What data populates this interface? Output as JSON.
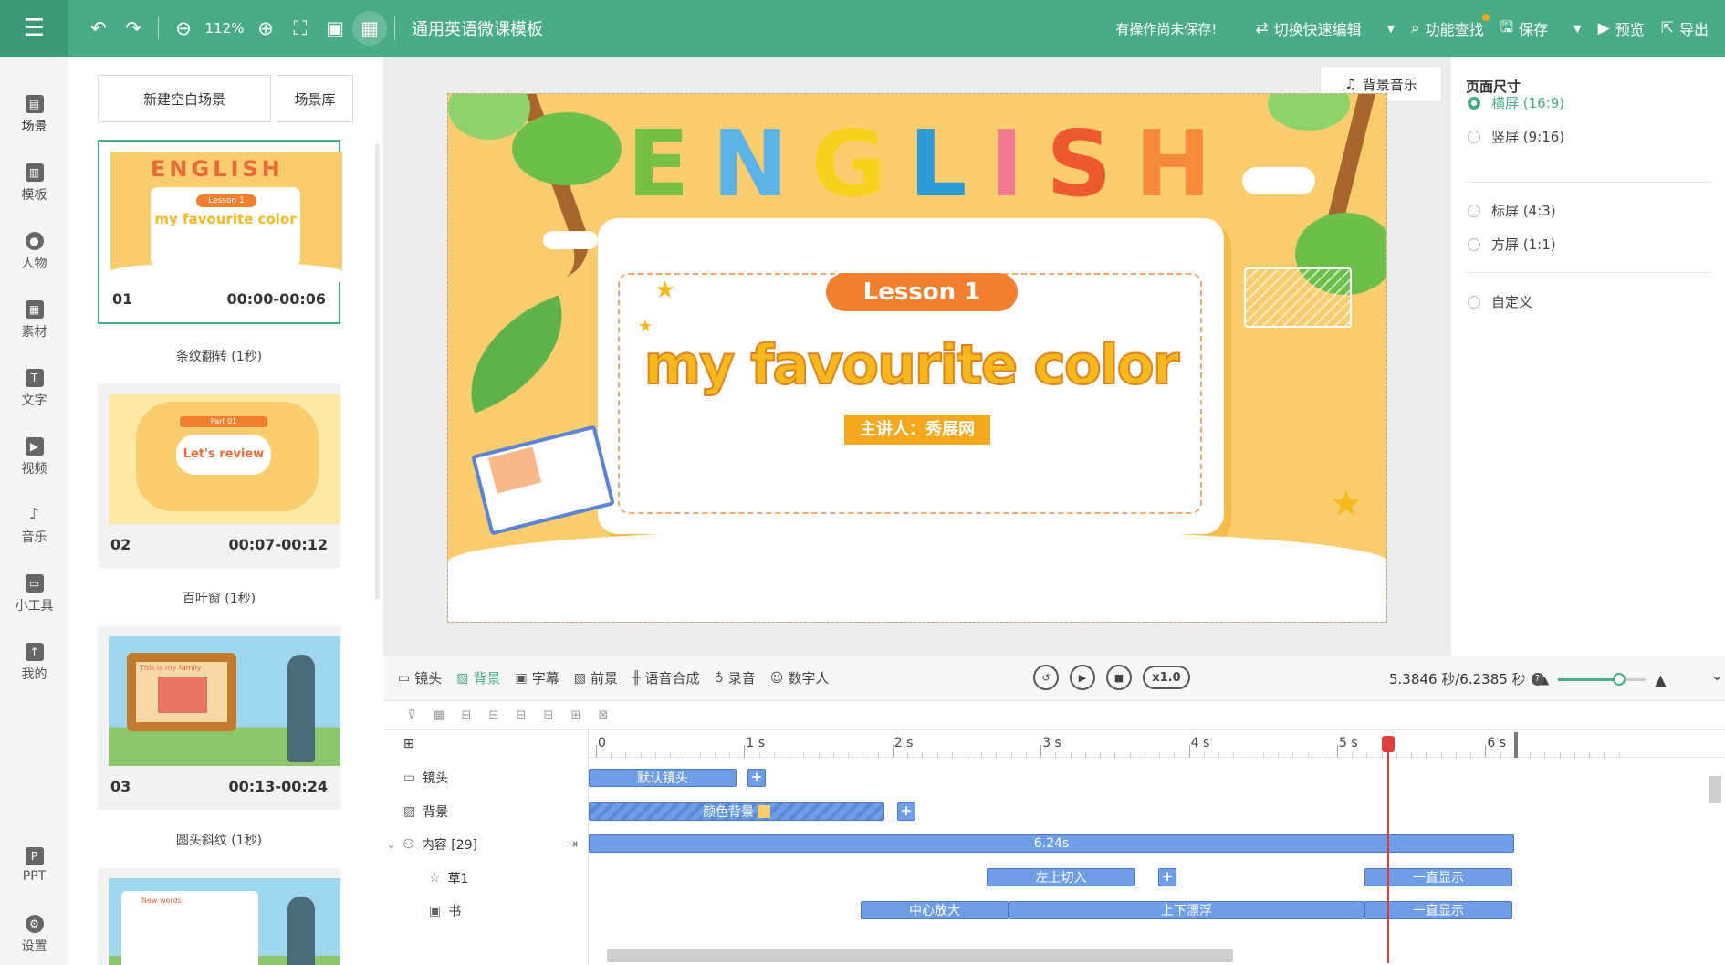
{
  "topbar": {
    "zoom": "112%",
    "app_title": "通用英语微课模板",
    "unsaved_notice": "有操作尚未保存!",
    "quick_edit": "切换快速编辑",
    "feature_search": "功能查找",
    "save": "保存",
    "preview": "预览",
    "export": "导出",
    "accent_color": "#4aac86"
  },
  "leftnav": {
    "items": [
      {
        "label": "场景",
        "icon": "scene-icon"
      },
      {
        "label": "模板",
        "icon": "template-icon"
      },
      {
        "label": "人物",
        "icon": "person-icon"
      },
      {
        "label": "素材",
        "icon": "material-icon"
      },
      {
        "label": "文字",
        "icon": "text-icon"
      },
      {
        "label": "视频",
        "icon": "video-icon"
      },
      {
        "label": "音乐",
        "icon": "music-icon"
      },
      {
        "label": "小工具",
        "icon": "toolbox-icon"
      },
      {
        "label": "我的",
        "icon": "upload-icon"
      },
      {
        "label": "PPT",
        "icon": "ppt-icon"
      },
      {
        "label": "设置",
        "icon": "gear-icon"
      }
    ]
  },
  "scenes": {
    "new_blank": "新建空白场景",
    "library": "场景库",
    "items": [
      {
        "num": "01",
        "time": "00:00-00:06",
        "transition": "条纹翻转 (1秒)"
      },
      {
        "num": "02",
        "time": "00:07-00:12",
        "transition": "百叶窗 (1秒)"
      },
      {
        "num": "03",
        "time": "00:13-00:24",
        "transition": "圆头斜纹 (1秒)"
      }
    ],
    "thumb1": {
      "title": "ENGLISH",
      "lesson": "Lesson 1",
      "subtitle": "my favourite color"
    },
    "thumb2": {
      "part": "Part 01",
      "text": "Let's review"
    },
    "thumb3": {
      "caption": "This is my family"
    },
    "thumb4": {
      "caption": "New words"
    }
  },
  "canvas": {
    "bgm_button": "背景音乐",
    "title_letters": [
      "E",
      "N",
      "G",
      "L",
      "I",
      "S",
      "H"
    ],
    "lesson": "Lesson 1",
    "headline": "my favourite color",
    "presenter": "主讲人：秀展网"
  },
  "props": {
    "heading": "页面尺寸",
    "options": [
      {
        "label": "横屏 (16:9)",
        "selected": true
      },
      {
        "label": "竖屏 (9:16)",
        "selected": false
      },
      {
        "label": "标屏 (4:3)",
        "selected": false
      },
      {
        "label": "方屏 (1:1)",
        "selected": false
      },
      {
        "label": "自定义",
        "selected": false
      }
    ]
  },
  "timeline": {
    "tabs": [
      {
        "label": "镜头",
        "icon": "camera-icon"
      },
      {
        "label": "背景",
        "icon": "background-icon"
      },
      {
        "label": "字幕",
        "icon": "subtitle-icon"
      },
      {
        "label": "前景",
        "icon": "foreground-icon"
      },
      {
        "label": "语音合成",
        "icon": "tts-icon"
      },
      {
        "label": "录音",
        "icon": "mic-icon"
      },
      {
        "label": "数字人",
        "icon": "avatar-icon"
      }
    ],
    "speed": "x1.0",
    "time_readout": "5.3846 秒/6.2385 秒",
    "zoom_level": 0.62,
    "ruler": [
      "0",
      "1 s",
      "2 s",
      "3 s",
      "4 s",
      "5 s",
      "6 s"
    ],
    "rows": [
      {
        "label": "镜头",
        "icon": "camera-icon"
      },
      {
        "label": "背景",
        "icon": "background-icon"
      },
      {
        "label": "内容 [29]",
        "icon": "content-icon"
      },
      {
        "label": "草1",
        "icon": "star-icon"
      },
      {
        "label": "书",
        "icon": "image-icon"
      }
    ],
    "clips": {
      "camera": "默认镜头",
      "background": "颜色背景",
      "content": "6.24s",
      "grass_in": "左上切入",
      "grass_show": "一直显示",
      "book_zoom": "中心放大",
      "book_float": "上下漂浮",
      "book_show": "一直显示"
    }
  }
}
